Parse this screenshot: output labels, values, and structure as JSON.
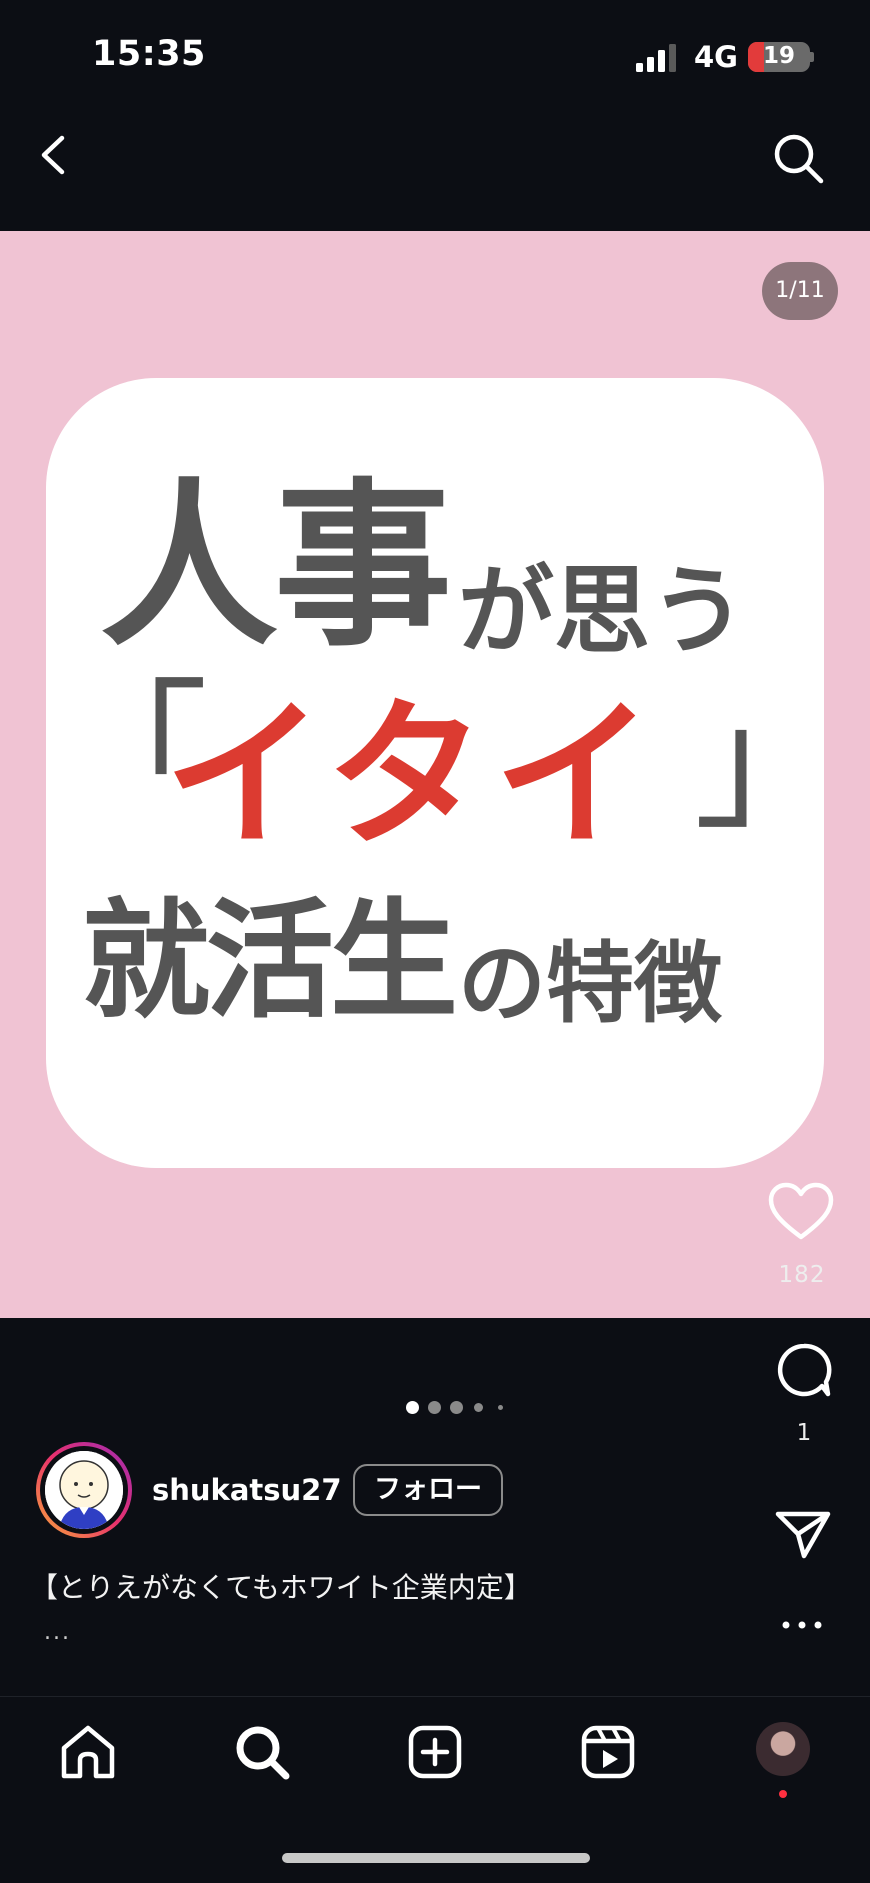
{
  "status_bar": {
    "time": "15:35",
    "network": "4G",
    "battery": "19",
    "battery_level": 0.19
  },
  "post": {
    "page_counter": "1/11",
    "title_card": {
      "line1_big": "人事",
      "line1_small": "が思う",
      "bracket_open": "「",
      "line2_red": "イタイ",
      "bracket_close": "」",
      "line3_big": "就活生",
      "line3_small": "の特徴"
    },
    "like_count": "182",
    "comment_count": "1",
    "carousel": {
      "total_visible_dots": 5,
      "active_index": 0
    }
  },
  "profile": {
    "username": "shukatsu27",
    "follow_label": "フォロー"
  },
  "caption": {
    "text": "【とりえがなくてもホワイト企業内定】",
    "more": "..."
  },
  "tab_bar": {
    "items": [
      "home",
      "search",
      "create",
      "reels",
      "profile"
    ]
  },
  "colors": {
    "background": "#0c0e14",
    "media_bg": "#f0c3d3",
    "title_gray": "#555555",
    "title_red": "#dc3b31",
    "notification": "#ff3040"
  }
}
